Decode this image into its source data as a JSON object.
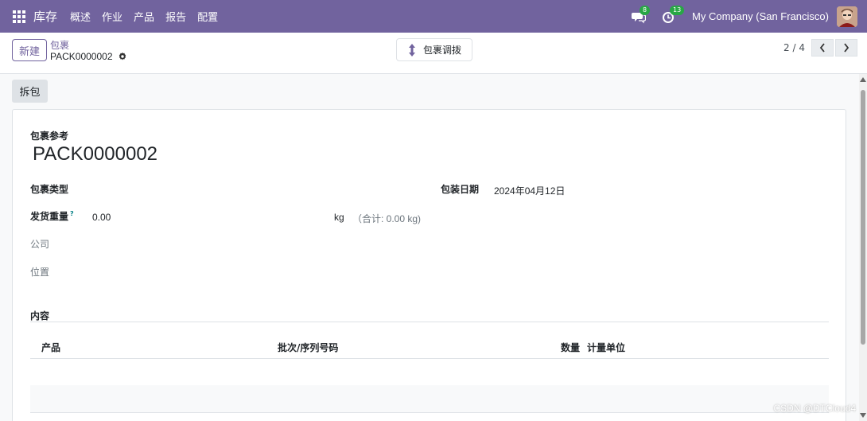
{
  "navbar": {
    "app_name": "库存",
    "menu": [
      "概述",
      "作业",
      "产品",
      "报告",
      "配置"
    ],
    "messages_count": "8",
    "activities_count": "13",
    "company": "My Company (San Francisco)"
  },
  "control_panel": {
    "new_label": "新建",
    "breadcrumb_parent": "包裹",
    "record_name": "PACK0000002",
    "transfer_label": "包裹调拨",
    "pager_value": "2 / 4"
  },
  "statusbar": {
    "unpack_label": "拆包"
  },
  "form": {
    "reference_label": "包裹参考",
    "reference_value": "PACK0000002",
    "package_type_label": "包裹类型",
    "pack_date_label": "包装日期",
    "pack_date_value": "2024年04月12日",
    "shipping_weight_label": "发货重量",
    "help_mark": "?",
    "shipping_weight_value": "0.00",
    "weight_unit": "kg",
    "weight_total": "（合计: 0.00 kg)",
    "company_label": "公司",
    "location_label": "位置",
    "content_label": "内容",
    "table": {
      "headers": [
        "产品",
        "批次/序列号码",
        "数量",
        "计量单位"
      ]
    }
  },
  "watermark": "CSDN @DTCloud4",
  "colors": {
    "brand": "#71639e",
    "badge": "#28a745"
  },
  "icons": [
    "apps-grid-icon",
    "chat-icon",
    "clock-icon",
    "gear-icon",
    "up-down-arrow-icon",
    "chevron-left-icon",
    "chevron-right-icon"
  ]
}
